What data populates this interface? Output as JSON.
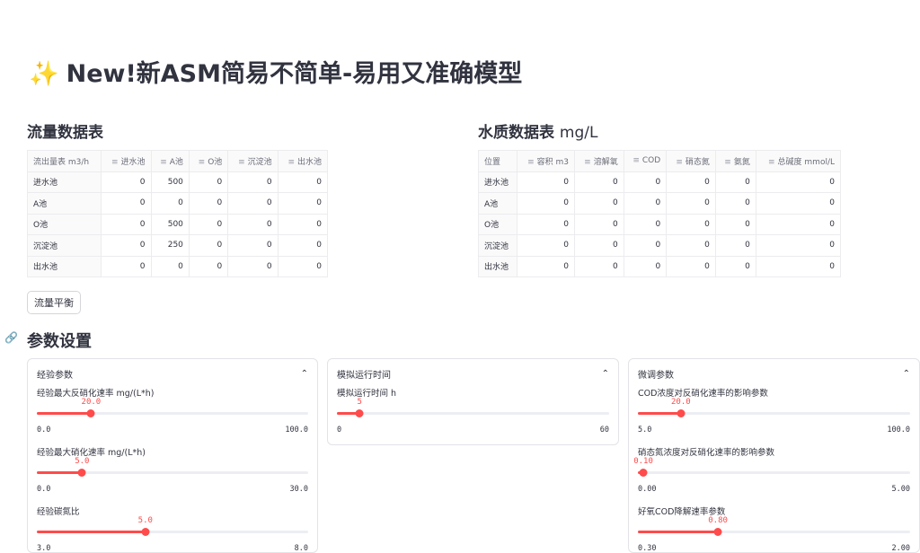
{
  "title": "New!新ASM简易不简单-易用又准确模型",
  "flow_table": {
    "heading": "流量数据表",
    "columns": [
      "流出量表 m3/h",
      "进水池",
      "A池",
      "O池",
      "沉淀池",
      "出水池"
    ],
    "rows": [
      [
        "进水池",
        "0",
        "500",
        "0",
        "0",
        "0"
      ],
      [
        "A池",
        "0",
        "0",
        "0",
        "0",
        "0"
      ],
      [
        "O池",
        "0",
        "500",
        "0",
        "0",
        "0"
      ],
      [
        "沉淀池",
        "0",
        "250",
        "0",
        "0",
        "0"
      ],
      [
        "出水池",
        "0",
        "0",
        "0",
        "0",
        "0"
      ]
    ]
  },
  "quality_table": {
    "heading": "水质数据表",
    "heading_unit": "mg/L",
    "columns": [
      "位置",
      "容积 m3",
      "溶解氧",
      "COD",
      "硝态氮",
      "氨氮",
      "总碱度 mmol/L"
    ],
    "rows": [
      [
        "进水池",
        "0",
        "0",
        "0",
        "0",
        "0",
        "0"
      ],
      [
        "A池",
        "0",
        "0",
        "0",
        "0",
        "0",
        "0"
      ],
      [
        "O池",
        "0",
        "0",
        "0",
        "0",
        "0",
        "0"
      ],
      [
        "沉淀池",
        "0",
        "0",
        "0",
        "0",
        "0",
        "0"
      ],
      [
        "出水池",
        "0",
        "0",
        "0",
        "0",
        "0",
        "0"
      ]
    ]
  },
  "balance_button": "流量平衡",
  "params_heading": "参数设置",
  "panels": [
    {
      "title": "经验参数",
      "sliders": [
        {
          "label": "经验最大反硝化速率 mg/(L*h)",
          "value": "20.0",
          "min": "0.0",
          "max": "100.0",
          "fraction": 0.2
        },
        {
          "label": "经验最大硝化速率 mg/(L*h)",
          "value": "5.0",
          "min": "0.0",
          "max": "30.0",
          "fraction": 0.1667
        },
        {
          "label": "经验碳氮比",
          "value": "5.0",
          "min": "3.0",
          "max": "8.0",
          "fraction": 0.4
        }
      ]
    },
    {
      "title": "模拟运行时间",
      "sliders": [
        {
          "label": "模拟运行时间 h",
          "value": "5",
          "min": "0",
          "max": "60",
          "fraction": 0.0833
        }
      ]
    },
    {
      "title": "微调参数",
      "sliders": [
        {
          "label": "COD浓度对反硝化速率的影响参数",
          "value": "20.0",
          "min": "5.0",
          "max": "100.0",
          "fraction": 0.1579
        },
        {
          "label": "硝态氮浓度对反硝化速率的影响参数",
          "value": "0.10",
          "min": "0.00",
          "max": "5.00",
          "fraction": 0.02
        },
        {
          "label": "好氧COD降解速率参数",
          "value": "0.80",
          "min": "0.30",
          "max": "2.00",
          "fraction": 0.2941
        }
      ]
    }
  ],
  "colors": {
    "accent": "#ff4b4b",
    "text": "#31333f"
  }
}
